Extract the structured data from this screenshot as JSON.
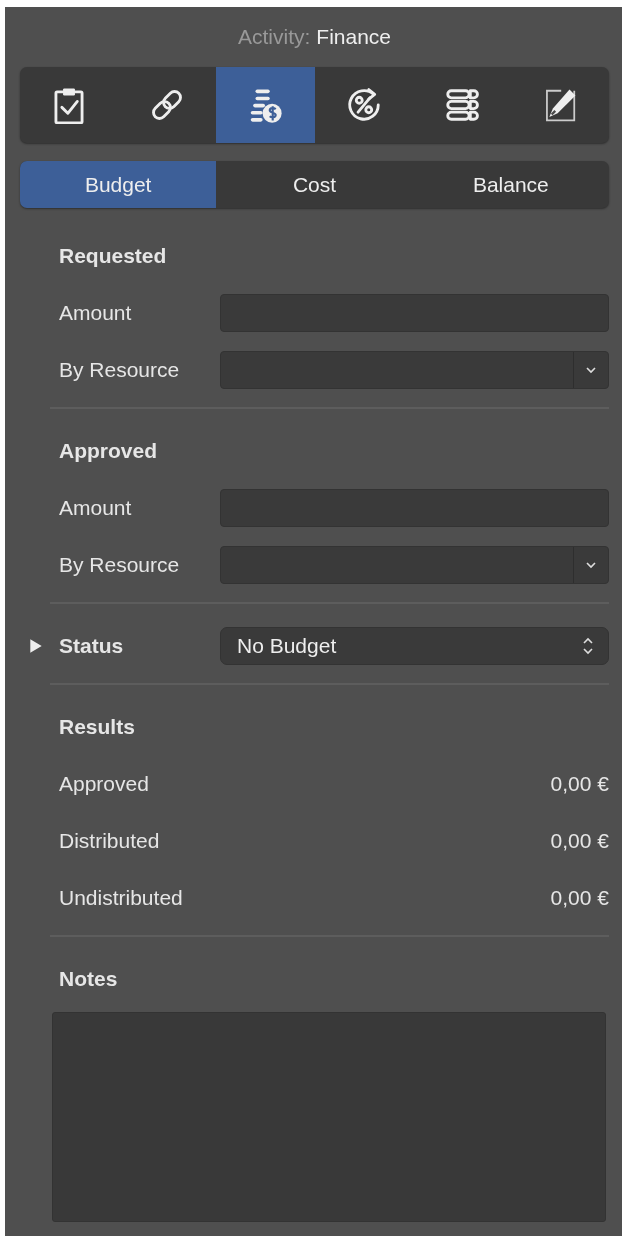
{
  "header": {
    "label": "Activity:",
    "value": "Finance"
  },
  "icon_tabs": [
    {
      "kind": "clipboard",
      "selected": false
    },
    {
      "kind": "link",
      "selected": false
    },
    {
      "kind": "coins",
      "selected": true
    },
    {
      "kind": "percent",
      "selected": false
    },
    {
      "kind": "list",
      "selected": false
    },
    {
      "kind": "edit",
      "selected": false
    }
  ],
  "segments": [
    {
      "label": "Budget",
      "selected": true
    },
    {
      "label": "Cost",
      "selected": false
    },
    {
      "label": "Balance",
      "selected": false
    }
  ],
  "sections": [
    {
      "kind": "fields",
      "title": "Requested",
      "rows": [
        {
          "label": "Amount",
          "kind": "text"
        },
        {
          "label": "By Resource",
          "kind": "dropdown"
        }
      ]
    },
    {
      "kind": "fields",
      "title": "Approved",
      "rows": [
        {
          "label": "Amount",
          "kind": "text"
        },
        {
          "label": "By Resource",
          "kind": "dropdown"
        }
      ]
    },
    {
      "kind": "status",
      "label": "Status",
      "expanded": false,
      "value": "No Budget"
    },
    {
      "kind": "results",
      "title": "Results",
      "rows": [
        {
          "label": "Approved",
          "value": "0,00 €"
        },
        {
          "label": "Distributed",
          "value": "0,00 €"
        },
        {
          "label": "Undistributed",
          "value": "0,00 €"
        }
      ]
    },
    {
      "kind": "notes",
      "title": "Notes"
    }
  ]
}
